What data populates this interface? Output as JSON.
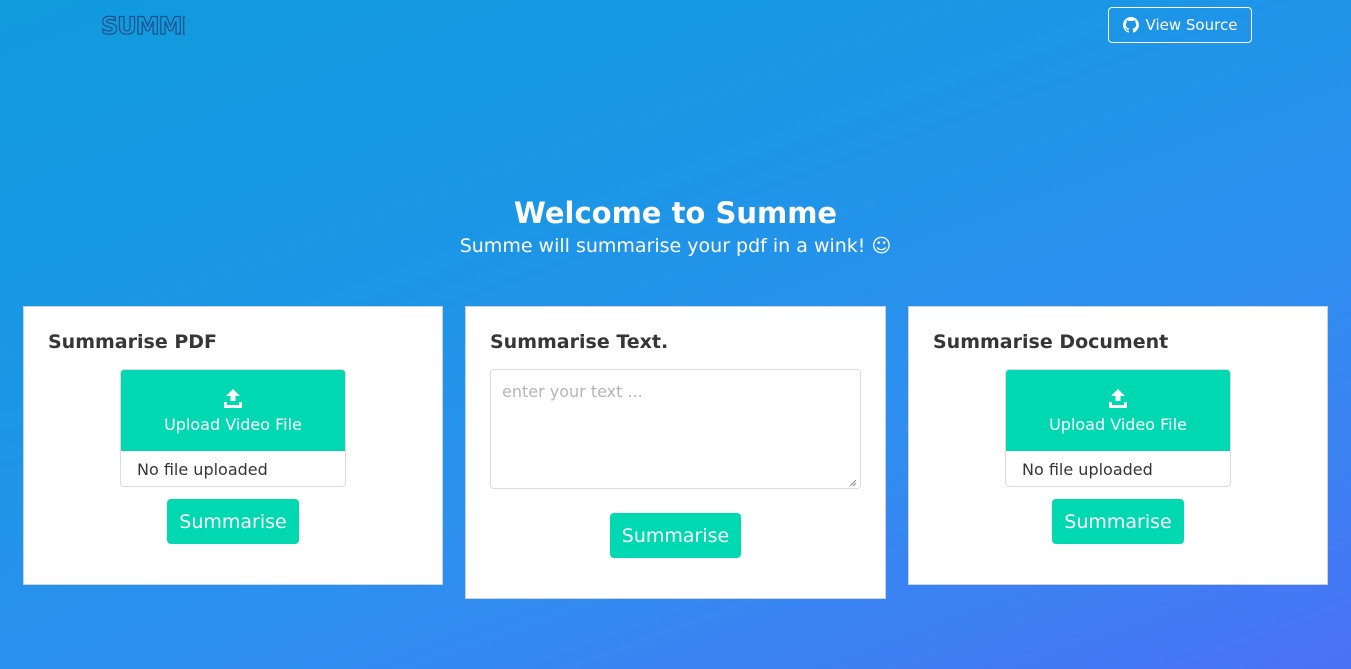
{
  "header": {
    "logo_text": "SUMME",
    "view_source_label": "View Source",
    "view_source_icon": "github-icon"
  },
  "hero": {
    "title": "Welcome to Summe",
    "subtitle": "Summe will summarise your pdf in a wink! ☺"
  },
  "cards": {
    "pdf": {
      "title": "Summarise PDF",
      "upload_label": "Upload Video File",
      "file_status": "No file uploaded",
      "button_label": "Summarise"
    },
    "text": {
      "title": "Summarise Text.",
      "placeholder": "enter your text ...",
      "button_label": "Summarise"
    },
    "document": {
      "title": "Summarise Document",
      "upload_label": "Upload Video File",
      "file_status": "No file uploaded",
      "button_label": "Summarise"
    }
  },
  "colors": {
    "accent": "#00d8b2",
    "background_start": "#0f9bdc",
    "background_end": "#4a72f5",
    "card_title": "#363636"
  }
}
